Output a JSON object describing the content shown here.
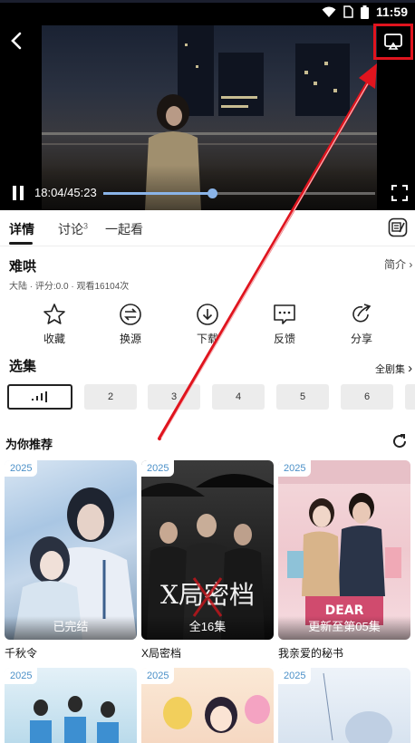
{
  "status_bar": {
    "time": "11:59",
    "icons": [
      "wifi-icon",
      "sim-icon",
      "battery-icon"
    ]
  },
  "player": {
    "current_time": "18:04",
    "total_time": "45:23",
    "time_display": "18:04/45:23",
    "progress": 0.4,
    "highlight_color": "#e0141e"
  },
  "tabs": [
    {
      "label": "详情",
      "active": true
    },
    {
      "label": "讨论",
      "badge": "3"
    },
    {
      "label": "一起看"
    }
  ],
  "detail": {
    "title": "难哄",
    "intro_link": "简介",
    "meta": "大陆 · 评分:0.0 · 观看16104次"
  },
  "actions": [
    {
      "label": "收藏",
      "icon": "star-icon"
    },
    {
      "label": "换源",
      "icon": "switch-source-icon"
    },
    {
      "label": "下载",
      "icon": "download-icon"
    },
    {
      "label": "反馈",
      "icon": "feedback-icon"
    },
    {
      "label": "分享",
      "icon": "share-icon"
    }
  ],
  "episodes": {
    "header": "选集",
    "all_label": "全剧集",
    "items": [
      "",
      "2",
      "3",
      "4",
      "5",
      "6"
    ]
  },
  "recommend": {
    "header": "为你推荐",
    "cards": [
      {
        "year": "2025",
        "caption": "已完结",
        "title": "千秋令"
      },
      {
        "year": "2025",
        "caption": "全16集",
        "title": "X局密档"
      },
      {
        "year": "2025",
        "caption": "更新至第05集",
        "title": "我亲爱的秘书"
      },
      {
        "year": "2025",
        "caption": "",
        "title": ""
      },
      {
        "year": "2025",
        "caption": "",
        "title": ""
      },
      {
        "year": "2025",
        "caption": "",
        "title": ""
      }
    ]
  }
}
